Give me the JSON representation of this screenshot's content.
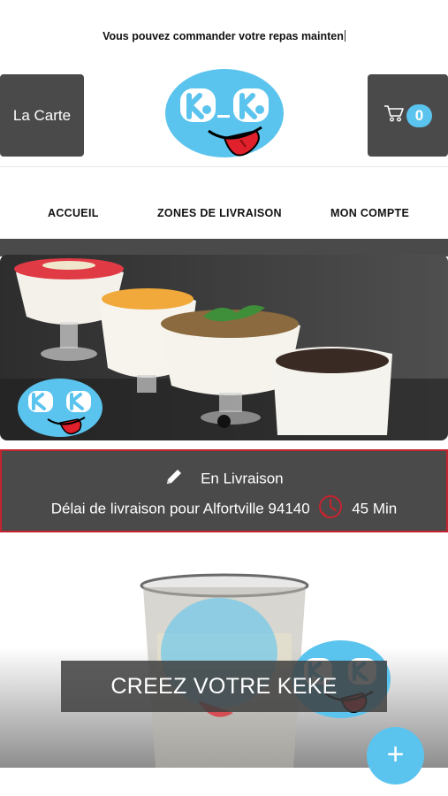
{
  "announcement": "Vous pouvez commander votre repas mainten",
  "header": {
    "menu_button_label": "La Carte",
    "cart_count": "0",
    "logo_alt": "Ké Ké"
  },
  "nav": {
    "items": [
      {
        "label": "ACCUEIL"
      },
      {
        "label": "ZONES DE LIVRAISON"
      },
      {
        "label": "MON COMPTE"
      }
    ]
  },
  "delivery": {
    "mode": "En Livraison",
    "delay_text": "Délai de livraison pour Alfortville 94140",
    "delay_value": "45 Min"
  },
  "promo": {
    "banner_text": "CREEZ VOTRE KEKE"
  },
  "fab": {
    "symbol": "+"
  },
  "colors": {
    "brand_blue": "#5bc4ee",
    "dark_gray": "#4a4a4a",
    "alert_red": "#c4242f"
  },
  "icons": [
    "cart-icon",
    "pencil-icon",
    "timer-icon",
    "plus-icon"
  ]
}
